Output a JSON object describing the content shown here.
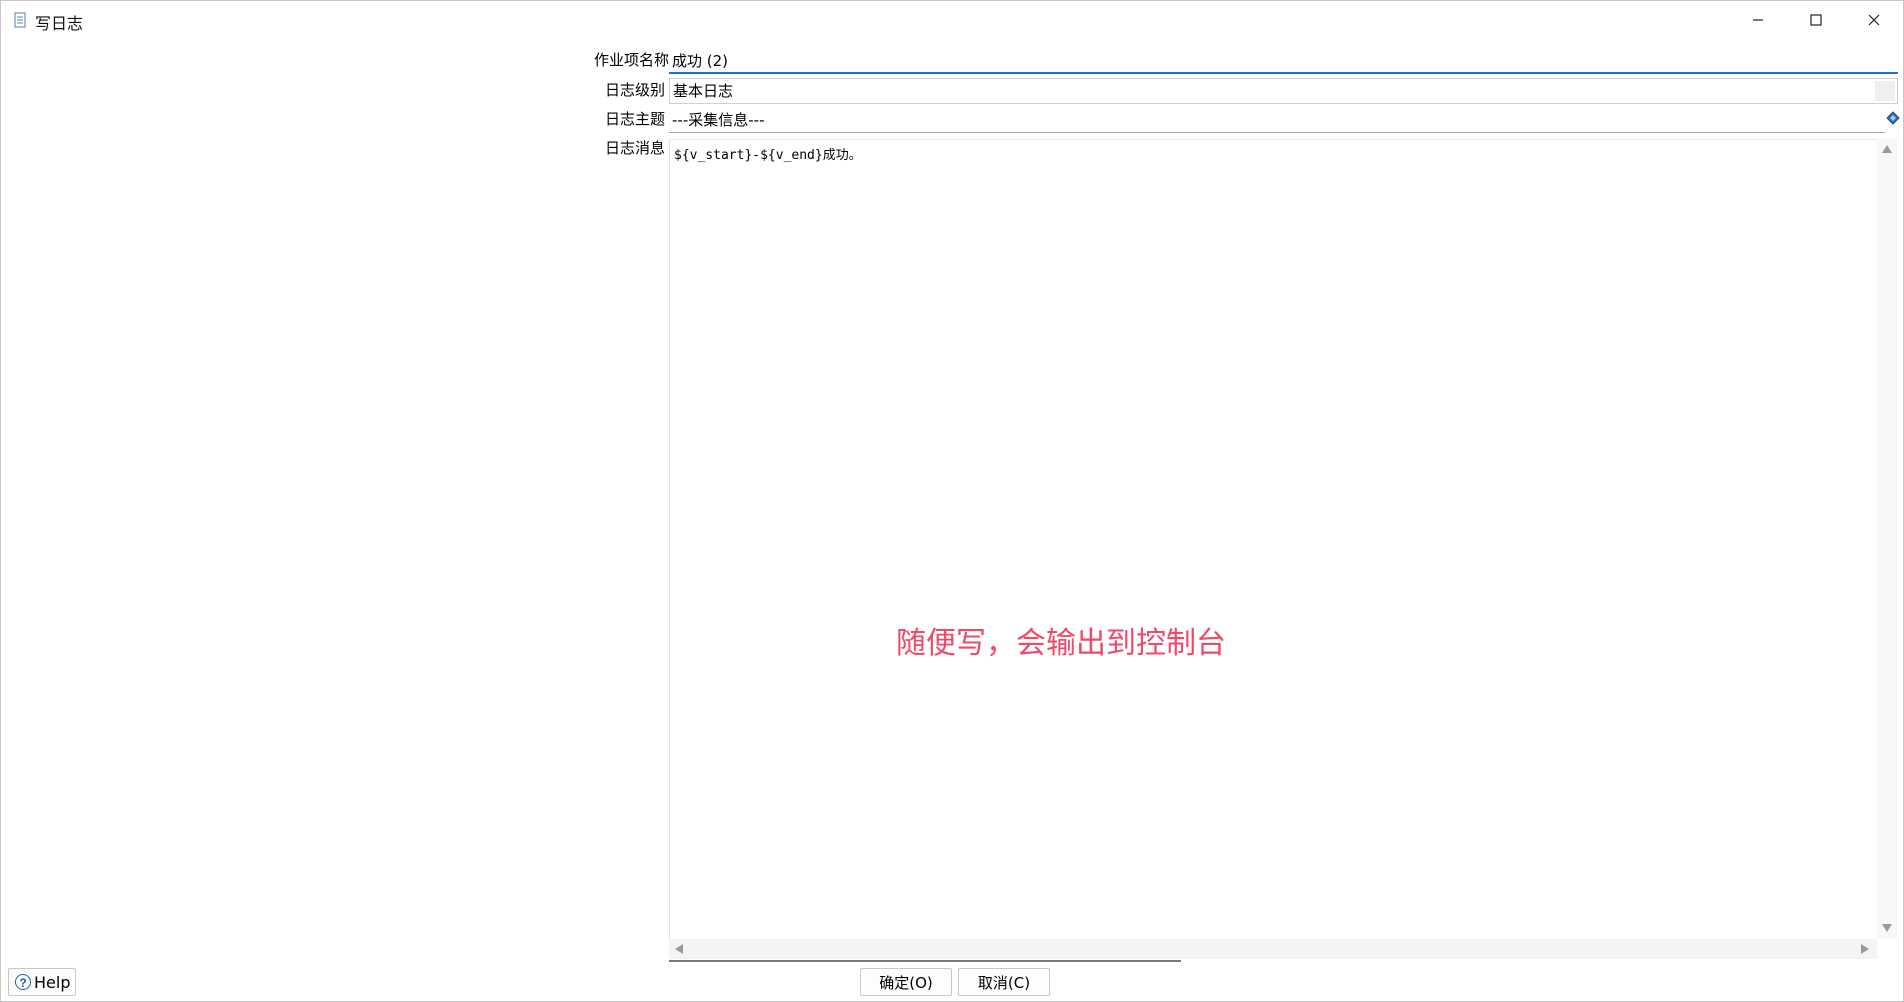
{
  "window": {
    "title": "写日志",
    "minimize_icon": "minimize-icon",
    "maximize_icon": "maximize-icon",
    "close_icon": "close-icon"
  },
  "form": {
    "job_name": {
      "label": "作业项名称",
      "value": "成功 (2)"
    },
    "log_level": {
      "label": "日志级别",
      "value": "基本日志"
    },
    "log_subject": {
      "label": "日志主题",
      "value": "---采集信息---"
    },
    "log_message": {
      "label": "日志消息",
      "value": "${v_start}-${v_end}成功。"
    }
  },
  "annotation": {
    "text": "随便写，会输出到控制台",
    "color": "#f0496a"
  },
  "footer": {
    "help_label": "Help",
    "ok_label": "确定(O)",
    "cancel_label": "取消(C)"
  }
}
